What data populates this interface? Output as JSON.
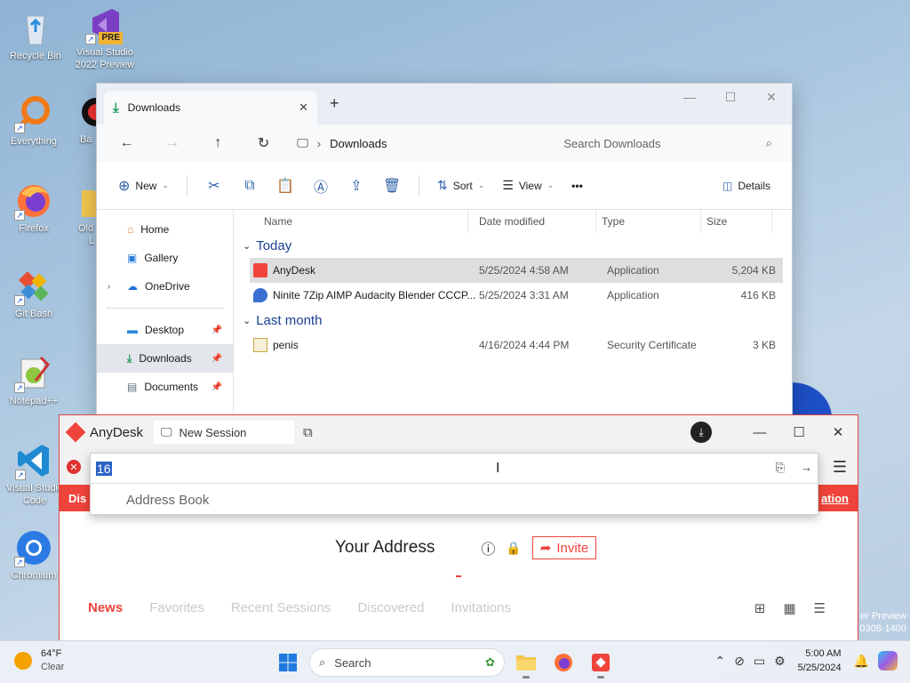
{
  "desktop": {
    "icons": [
      {
        "label": "Recycle Bin"
      },
      {
        "label": "Visual Studio 2022 Preview",
        "badge": "PRE"
      },
      {
        "label": "Everything"
      },
      {
        "label": "Ba"
      },
      {
        "label": "Firefox"
      },
      {
        "label": "Old",
        "sub": "L"
      },
      {
        "label": "Git Bash"
      },
      {
        "label": "Notepad++"
      },
      {
        "label": "Visual Studio Code"
      },
      {
        "label": "Chromium"
      }
    ],
    "watermark": [
      "er Preview",
      "0308-1400"
    ]
  },
  "explorer": {
    "tab_title": "Downloads",
    "breadcrumb": "Downloads",
    "search_placeholder": "Search Downloads",
    "toolbar": {
      "new": "New",
      "sort": "Sort",
      "view": "View",
      "more": "•••",
      "details": "Details"
    },
    "sidebar": [
      {
        "label": "Home",
        "pinned": false
      },
      {
        "label": "Gallery",
        "pinned": false
      },
      {
        "label": "OneDrive",
        "pinned": false
      },
      {
        "label": "Desktop",
        "pinned": true
      },
      {
        "label": "Downloads",
        "pinned": true,
        "selected": true
      },
      {
        "label": "Documents",
        "pinned": true
      }
    ],
    "columns": {
      "name": "Name",
      "date": "Date modified",
      "type": "Type",
      "size": "Size"
    },
    "groups": [
      {
        "label": "Today",
        "files": [
          {
            "name": "AnyDesk",
            "date": "5/25/2024 4:58 AM",
            "type": "Application",
            "size": "5,204 KB",
            "selected": true
          },
          {
            "name": "Ninite 7Zip AIMP Audacity Blender CCCP...",
            "date": "5/25/2024 3:31 AM",
            "type": "Application",
            "size": "416 KB"
          }
        ]
      },
      {
        "label": "Last month",
        "files": [
          {
            "name": "penis",
            "date": "4/16/2024 4:44 PM",
            "type": "Security Certificate",
            "size": "3 KB"
          }
        ]
      }
    ]
  },
  "anydesk": {
    "app_name": "AnyDesk",
    "tab_label": "New Session",
    "address_value": "16",
    "dropdown_item": "Address Book",
    "banner_left": "Dis",
    "banner_right": "ation",
    "your_address_label": "Your Address",
    "invite_label": "Invite",
    "tabs": [
      "News",
      "Favorites",
      "Recent Sessions",
      "Discovered",
      "Invitations"
    ],
    "active_tab": "News",
    "accent": "#ef443b"
  },
  "taskbar": {
    "weather_temp": "64°F",
    "weather_cond": "Clear",
    "search_label": "Search",
    "time": "5:00 AM",
    "date": "5/25/2024"
  }
}
